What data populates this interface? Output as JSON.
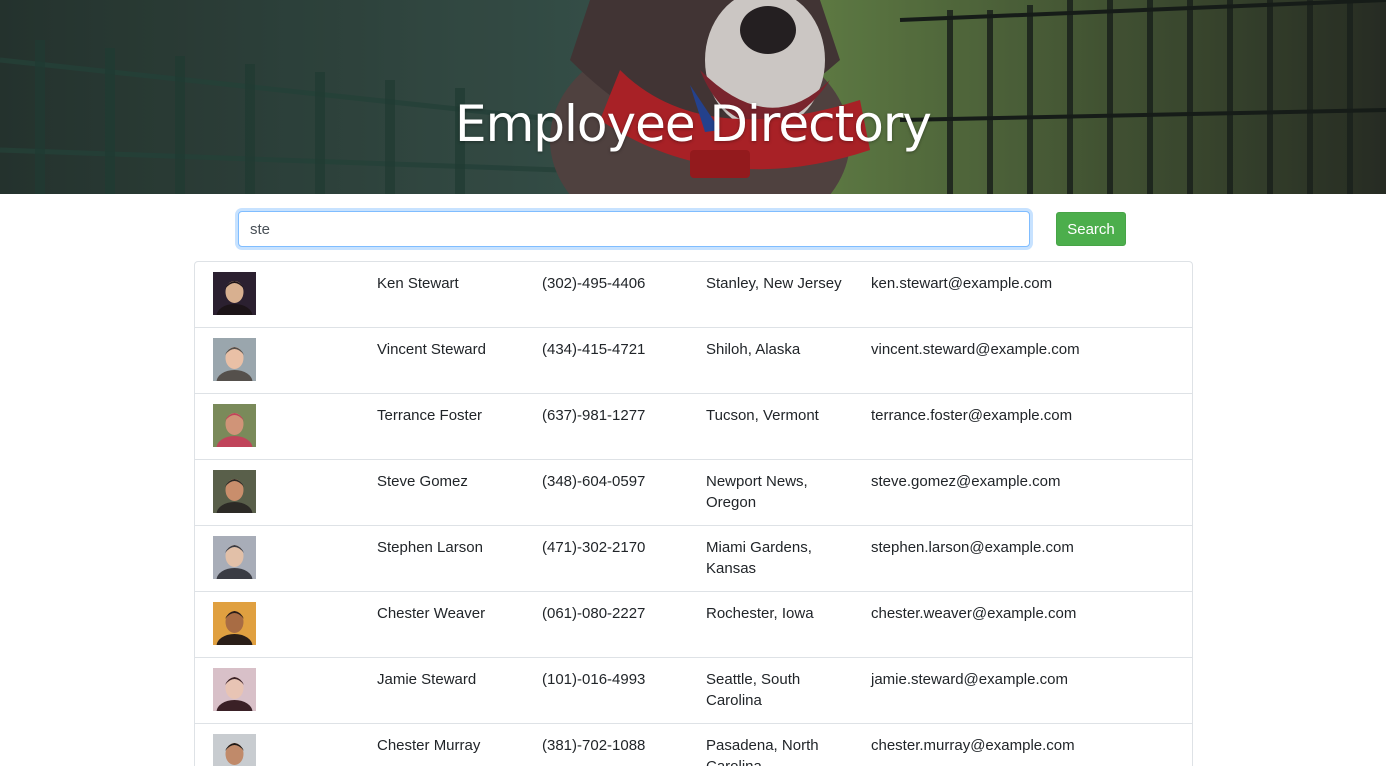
{
  "header": {
    "title": "Employee Directory"
  },
  "search": {
    "value": "ste",
    "button_label": "Search"
  },
  "employees": [
    {
      "name": "Ken Stewart",
      "phone": "(302)-495-4406",
      "location": "Stanley, New Jersey",
      "email": "ken.stewart@example.com",
      "photo_colors": [
        "#2b2030",
        "#1c1418",
        "#d8b090"
      ]
    },
    {
      "name": "Vincent Steward",
      "phone": "(434)-415-4721",
      "location": "Shiloh, Alaska",
      "email": "vincent.steward@example.com",
      "photo_colors": [
        "#9aa6ad",
        "#55504c",
        "#e9c0a6"
      ]
    },
    {
      "name": "Terrance Foster",
      "phone": "(637)-981-1277",
      "location": "Tucson, Vermont",
      "email": "terrance.foster@example.com",
      "photo_colors": [
        "#7a8a5a",
        "#c0445a",
        "#d09478"
      ]
    },
    {
      "name": "Steve Gomez",
      "phone": "(348)-604-0597",
      "location": "Newport News, Oregon",
      "email": "steve.gomez@example.com",
      "photo_colors": [
        "#595f4a",
        "#2c2a26",
        "#c98e6c"
      ]
    },
    {
      "name": "Stephen Larson",
      "phone": "(471)-302-2170",
      "location": "Miami Gardens, Kansas",
      "email": "stephen.larson@example.com",
      "photo_colors": [
        "#a8adb8",
        "#3a3c44",
        "#e2c0a8"
      ]
    },
    {
      "name": "Chester Weaver",
      "phone": "(061)-080-2227",
      "location": "Rochester, Iowa",
      "email": "chester.weaver@example.com",
      "photo_colors": [
        "#e0a040",
        "#2a1e18",
        "#a86c44"
      ]
    },
    {
      "name": "Jamie Steward",
      "phone": "(101)-016-4993",
      "location": "Seattle, South Carolina",
      "email": "jamie.steward@example.com",
      "photo_colors": [
        "#d8c0c8",
        "#3a2026",
        "#e8c4b4"
      ]
    },
    {
      "name": "Chester Murray",
      "phone": "(381)-702-1088",
      "location": "Pasadena, North Carolina",
      "email": "chester.murray@example.com",
      "photo_colors": [
        "#c8ccd0",
        "#1e1a18",
        "#c08a6a"
      ]
    }
  ],
  "icons": {
    "avatar": "employee-photo"
  }
}
